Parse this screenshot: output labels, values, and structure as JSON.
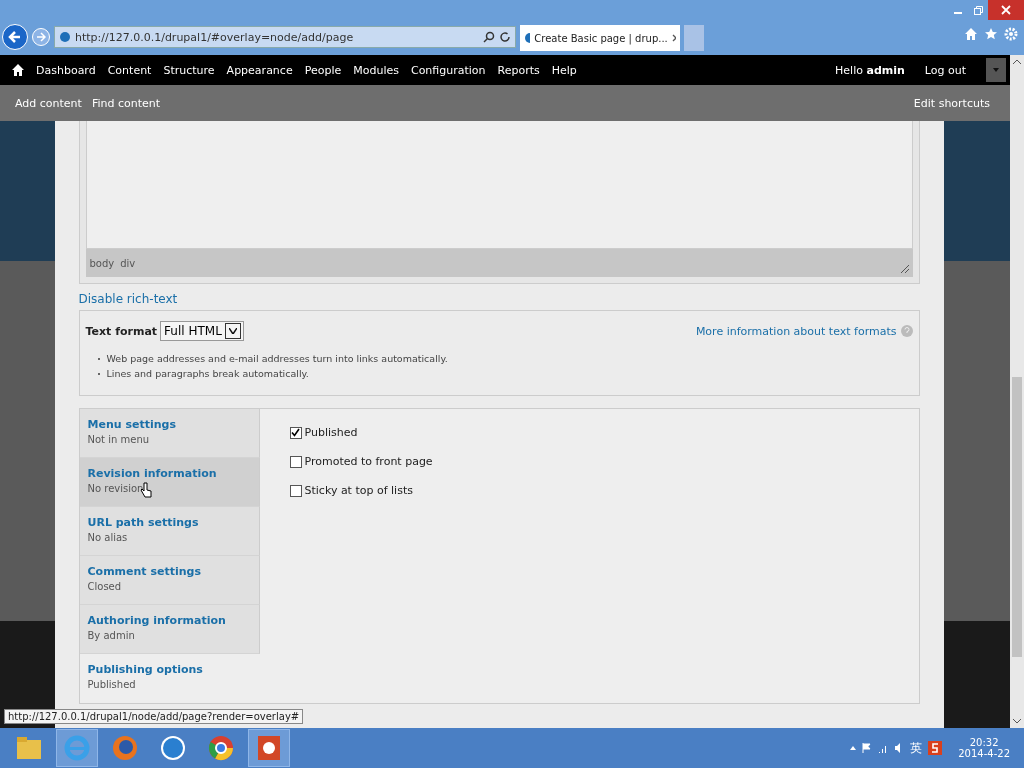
{
  "browser": {
    "address": "http://127.0.0.1/drupal1/#overlay=node/add/page",
    "tab_title": "Create Basic page | drup..."
  },
  "toolbar": {
    "items": [
      "Dashboard",
      "Content",
      "Structure",
      "Appearance",
      "People",
      "Modules",
      "Configuration",
      "Reports",
      "Help"
    ],
    "greeting": "Hello",
    "user": "admin",
    "logout": "Log out"
  },
  "shortcuts": {
    "items": [
      "Add content",
      "Find content"
    ],
    "edit": "Edit shortcuts"
  },
  "editor": {
    "path": [
      "body",
      "div"
    ]
  },
  "disable_rich_text": "Disable rich-text",
  "text_format": {
    "label": "Text format",
    "value": "Full HTML",
    "more_info": "More information about text formats",
    "tips": [
      "Web page addresses and e-mail addresses turn into links automatically.",
      "Lines and paragraphs break automatically."
    ]
  },
  "vertical_tabs": [
    {
      "title": "Menu settings",
      "summary": "Not in menu",
      "selected": false,
      "hovered": false
    },
    {
      "title": "Revision information",
      "summary": "No revision",
      "selected": false,
      "hovered": true
    },
    {
      "title": "URL path settings",
      "summary": "No alias",
      "selected": false,
      "hovered": false
    },
    {
      "title": "Comment settings",
      "summary": "Closed",
      "selected": false,
      "hovered": false
    },
    {
      "title": "Authoring information",
      "summary": "By admin",
      "selected": false,
      "hovered": false
    },
    {
      "title": "Publishing options",
      "summary": "Published",
      "selected": true,
      "hovered": false
    }
  ],
  "publishing": [
    {
      "label": "Published",
      "checked": true
    },
    {
      "label": "Promoted to front page",
      "checked": false
    },
    {
      "label": "Sticky at top of lists",
      "checked": false
    }
  ],
  "status_url": "http://127.0.0.1/drupal1/node/add/page?render=overlay#",
  "taskbar": {
    "apps": [
      {
        "kind": "folder",
        "active": false
      },
      {
        "kind": "ie",
        "active": true
      },
      {
        "kind": "firefox",
        "active": false
      },
      {
        "kind": "s",
        "active": false
      },
      {
        "kind": "chrome",
        "active": false
      },
      {
        "kind": "powerpoint",
        "active": true
      }
    ],
    "ime": "英",
    "time": "20:32",
    "date": "2014-4-22"
  }
}
